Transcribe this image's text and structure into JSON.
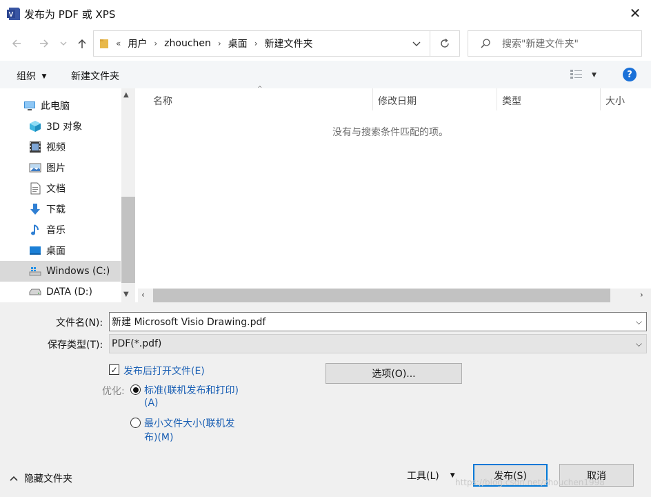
{
  "window": {
    "title": "发布为 PDF 或 XPS",
    "app_icon_letter": "V"
  },
  "address": {
    "overflow": "«",
    "crumbs": [
      "用户",
      "zhouchen",
      "桌面",
      "新建文件夹"
    ]
  },
  "search": {
    "placeholder": "搜索\"新建文件夹\""
  },
  "toolbar": {
    "organize_label": "组织",
    "new_folder_label": "新建文件夹",
    "help_label": "?"
  },
  "nav": {
    "items": [
      {
        "label": "此电脑",
        "icon": "computer-icon"
      },
      {
        "label": "3D 对象",
        "icon": "cube-icon"
      },
      {
        "label": "视频",
        "icon": "video-icon"
      },
      {
        "label": "图片",
        "icon": "picture-icon"
      },
      {
        "label": "文档",
        "icon": "document-icon"
      },
      {
        "label": "下载",
        "icon": "download-icon"
      },
      {
        "label": "音乐",
        "icon": "music-icon"
      },
      {
        "label": "桌面",
        "icon": "desktop-icon"
      },
      {
        "label": "Windows (C:)",
        "icon": "drive-c-icon",
        "selected": true
      },
      {
        "label": "DATA (D:)",
        "icon": "drive-d-icon"
      }
    ]
  },
  "filelist": {
    "columns": [
      "名称",
      "修改日期",
      "类型",
      "大小"
    ],
    "empty_message": "没有与搜索条件匹配的项。"
  },
  "form": {
    "filename_label": "文件名(N):",
    "filename_value": "新建 Microsoft Visio Drawing.pdf",
    "filetype_label": "保存类型(T):",
    "filetype_value": "PDF(*.pdf)",
    "open_after_label": "发布后打开文件(E)",
    "open_after_checked": true,
    "optimize_label": "优化:",
    "standard_label_line1": "标准(联机发布和打印)",
    "standard_label_line2": "(A)",
    "minimum_label_line1": "最小文件大小(联机发",
    "minimum_label_line2": "布)(M)",
    "options_button": "选项(O)..."
  },
  "footer": {
    "hide_folders": "隐藏文件夹",
    "tools": "工具(L)",
    "publish": "发布(S)",
    "cancel": "取消",
    "watermark": "https://blog.csdn.net/zhouchen1998"
  },
  "colors": {
    "accent": "#0078d7",
    "selection": "#d9d9d9",
    "link_blue": "#1a5fb4"
  }
}
